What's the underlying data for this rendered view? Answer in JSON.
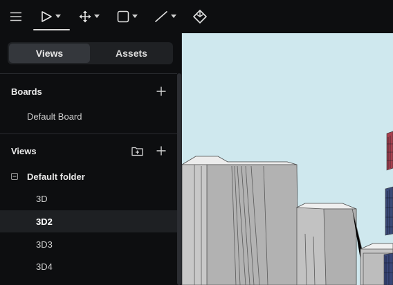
{
  "toolbar": {
    "tools": [
      {
        "name": "menu-icon"
      },
      {
        "name": "select-icon",
        "active": true
      },
      {
        "name": "move-icon"
      },
      {
        "name": "rectangle-icon"
      },
      {
        "name": "line-icon"
      },
      {
        "name": "plane-icon"
      }
    ]
  },
  "sidebar": {
    "tabs": {
      "views": "Views",
      "assets": "Assets",
      "active": "views"
    },
    "boards": {
      "title": "Boards",
      "items": [
        "Default Board"
      ]
    },
    "views": {
      "title": "Views",
      "folder": {
        "label": "Default folder",
        "expanded": true
      },
      "items": [
        "3D",
        "3D2",
        "3D3",
        "3D4"
      ],
      "selected": "3D2"
    }
  },
  "colors": {
    "background": "#0d0e10",
    "selected_row": "#1e2023",
    "sky": "#cfe8ee",
    "building": "#b8b8b8"
  }
}
